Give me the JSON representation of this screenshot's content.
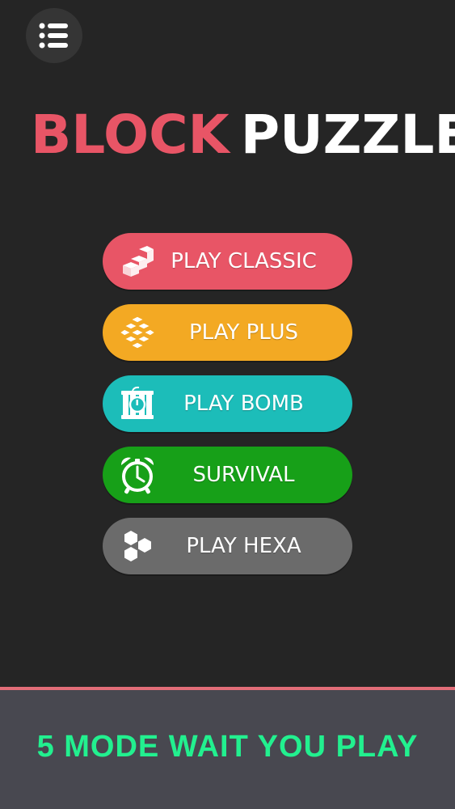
{
  "title": {
    "part1": "BLOCK",
    "part2": "PUZZLE"
  },
  "menu": {
    "icon": "menu-list-icon"
  },
  "modes": [
    {
      "label": "PLAY CLASSIC",
      "icon": "stair-blocks-icon",
      "color": "#e85566"
    },
    {
      "label": "PLAY PLUS",
      "icon": "plus-blocks-icon",
      "color": "#f3a923"
    },
    {
      "label": "PLAY BOMB",
      "icon": "bomb-icon",
      "color": "#1cbdb9"
    },
    {
      "label": "SURVIVAL",
      "icon": "alarm-clock-icon",
      "color": "#17a018"
    },
    {
      "label": "PLAY HEXA",
      "icon": "hexagons-icon",
      "color": "#6b6b6b"
    }
  ],
  "footer": {
    "tagline": "5 MODE WAIT YOU PLAY",
    "accent": "#22f08f"
  }
}
